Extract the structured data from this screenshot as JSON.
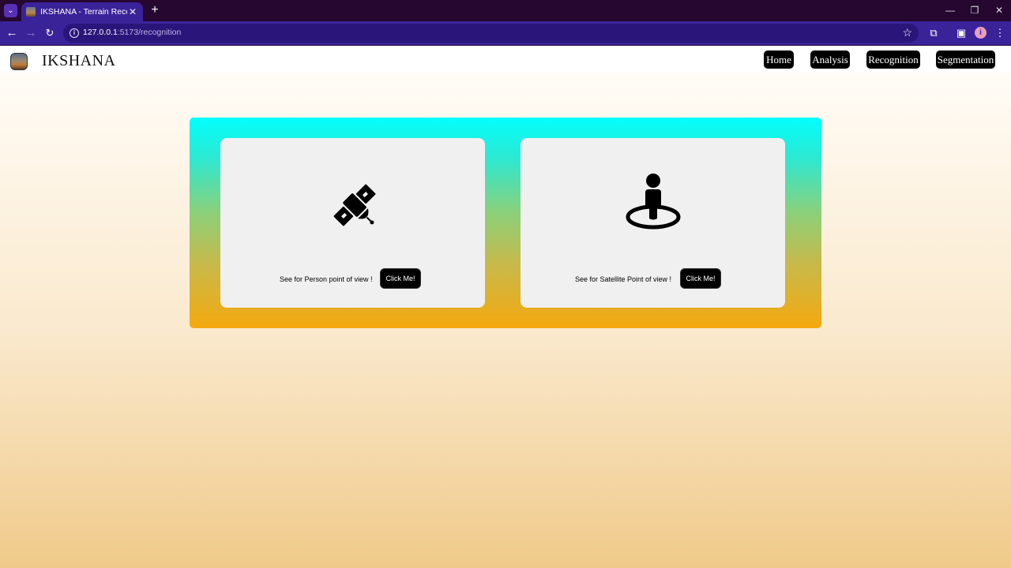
{
  "browser": {
    "tab_title": "IKSHANA - Terrain Recognition",
    "url_host": "127.0.0.1",
    "url_path": ":5173/recognition"
  },
  "header": {
    "brand": "IKSHANA",
    "nav": [
      "Home",
      "Analysis",
      "Recognition",
      "Segmentation"
    ]
  },
  "cards": [
    {
      "icon": "satellite-icon",
      "text": "See for Person point of view !",
      "button": "Click Me!"
    },
    {
      "icon": "person-location-icon",
      "text": "See for Satellite Point of view !",
      "button": "Click Me!"
    }
  ],
  "colors": {
    "panel_top": "#00ffff",
    "panel_bottom": "#f5a90f",
    "chrome": "#3a2399"
  }
}
